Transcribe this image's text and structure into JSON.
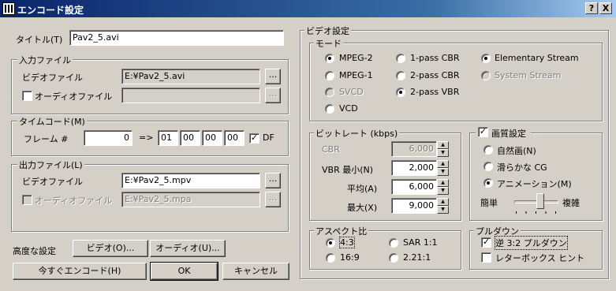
{
  "window": {
    "title": "エンコード設定",
    "help_label": "?",
    "close_label": "X"
  },
  "title_field": {
    "label": "タイトル(T)",
    "value": "Pav2_5.avi"
  },
  "input": {
    "group": "入力ファイル",
    "video_label": "ビデオファイル",
    "video_value": "E:¥Pav2_5.avi",
    "audio_label": "オーディオファイル",
    "audio_value": "",
    "browse": "..."
  },
  "timecode": {
    "group": "タイムコード(M)",
    "frame_label": "フレーム #",
    "frame_value": "0",
    "arrow": "=>",
    "hh": "01",
    "mm": "00",
    "ss": "00",
    "ff": "00",
    "df_label": "DF",
    "df_checked": true
  },
  "output": {
    "group": "出力ファイル(L)",
    "video_label": "ビデオファイル",
    "video_value": "E:¥Pav2_5.mpv",
    "audio_label": "オーディオファイル",
    "audio_value": "E:¥Pav2_5.mpa",
    "browse": "..."
  },
  "advanced": {
    "label": "高度な設定",
    "video_btn": "ビデオ(O)...",
    "audio_btn": "オーディオ(U)..."
  },
  "bottom": {
    "encode_btn": "今すぐエンコード(H)",
    "ok_btn": "OK",
    "cancel_btn": "キャンセル"
  },
  "video_settings": {
    "group": "ビデオ設定",
    "mode": {
      "group": "モード",
      "options": {
        "mpeg2": "MPEG-2",
        "pass1_cbr": "1-pass CBR",
        "elementary": "Elementary Stream",
        "mpeg1": "MPEG-1",
        "pass2_cbr": "2-pass CBR",
        "system": "System Stream",
        "svcd": "SVCD",
        "pass2_vbr": "2-pass VBR",
        "vcd": "VCD"
      }
    },
    "bitrate": {
      "group": "ビットレート (kbps)",
      "cbr_label": "CBR",
      "cbr_value": "6,000",
      "vbr_min_label": "VBR 最小(N)",
      "vbr_min_value": "2,000",
      "avg_label": "平均(A)",
      "avg_value": "6,000",
      "max_label": "最大(X)",
      "max_value": "9,000"
    },
    "quality": {
      "group": "画質設定",
      "checked": true,
      "natural": "自然画(N)",
      "smooth": "滑らかな CG",
      "anime": "アニメーション(M)",
      "simple": "簡単",
      "complex": "複雑"
    },
    "aspect": {
      "group": "アスペクト比",
      "r43": "4:3",
      "r169": "16:9",
      "sar11": "SAR 1:1",
      "r221": "2.21:1"
    },
    "pulldown": {
      "group": "プルダウン",
      "reverse32": "逆 3:2 プルダウン",
      "reverse32_checked": true,
      "letterbox": "レターボックス ヒント",
      "letterbox_checked": false
    }
  }
}
